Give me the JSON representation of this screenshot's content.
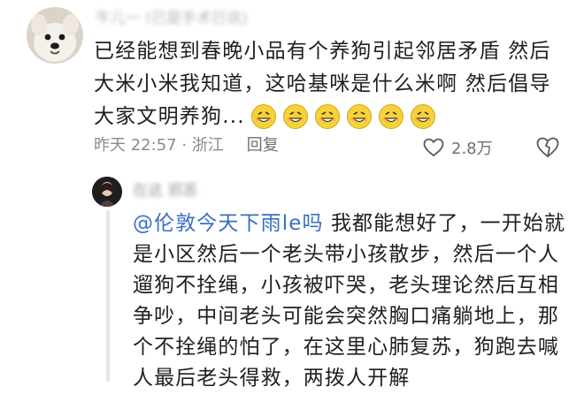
{
  "comment": {
    "username": "牛儿一 (已是手术已说)",
    "text": "已经能想到春晚小品有个养狗引起邻居矛盾 然后 大米小米我知道，这哈基咪是什么米啊 然后倡导大家文明养狗...",
    "emoji_icons": [
      "grin-emoji-icon",
      "grin-emoji-icon",
      "grin-emoji-icon",
      "grin-emoji-icon",
      "grin-emoji-icon",
      "grin-emoji-icon"
    ],
    "time": "昨天 22:57",
    "location": "浙江",
    "reply_label": "回复",
    "likes": "2.8万"
  },
  "reply": {
    "username": "在这 邪恶",
    "mention": "@伦敦今天下雨le吗",
    "text": " 我都能想好了，一开始就是小区然后一个老头带小孩散步，然后一个人遛狗不拴绳，小孩被吓哭，老头理论然后互相争吵，中间老头可能会突然胸口痛躺地上，那个不拴绳的怕了，在这里心肺复苏，狗跑去喊人最后老头得救，两拨人开解"
  },
  "colors": {
    "mention": "#3a6fc2",
    "meta_gray": "#8b8b8b",
    "text": "#1f1f1f"
  }
}
